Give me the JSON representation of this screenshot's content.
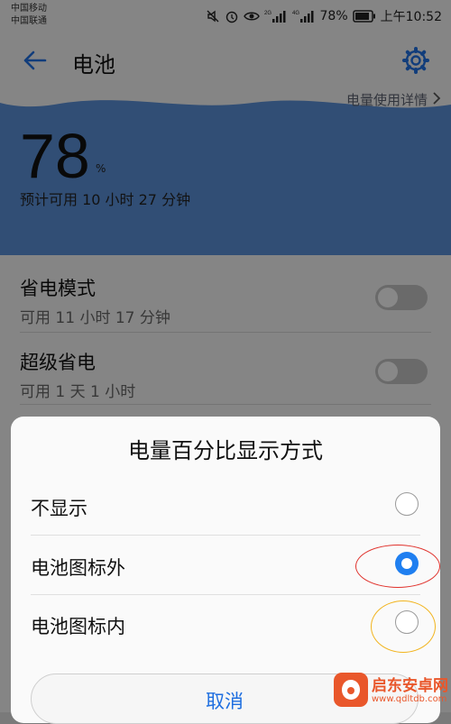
{
  "status": {
    "carrier1": "中国移动",
    "carrier2": "中国联通",
    "net1": "2G",
    "net2": "4G",
    "battery": "78%",
    "time": "上午10:52",
    "icons": [
      "mute-icon",
      "alarm-icon",
      "eye-icon",
      "signal-icon",
      "battery-icon"
    ]
  },
  "appbar": {
    "title": "电池"
  },
  "battery_card": {
    "usage_link": "电量使用详情",
    "percent": "78",
    "percent_unit": "%",
    "estimate": "预计可用 10 小时 27 分钟",
    "color": "#5a8fd6"
  },
  "modes": [
    {
      "title": "省电模式",
      "subtitle": "可用 11 小时 17 分钟",
      "enabled": false
    },
    {
      "title": "超级省电",
      "subtitle": "可用 1 天 1 小时",
      "enabled": false
    }
  ],
  "dialog": {
    "title": "电量百分比显示方式",
    "options": [
      {
        "label": "不显示",
        "selected": false
      },
      {
        "label": "电池图标外",
        "selected": true
      },
      {
        "label": "电池图标内",
        "selected": false
      }
    ],
    "cancel": "取消",
    "accent": "#1f7ff0"
  },
  "watermark": {
    "name": "启东安卓网",
    "url": "www.qdltdb.com"
  }
}
